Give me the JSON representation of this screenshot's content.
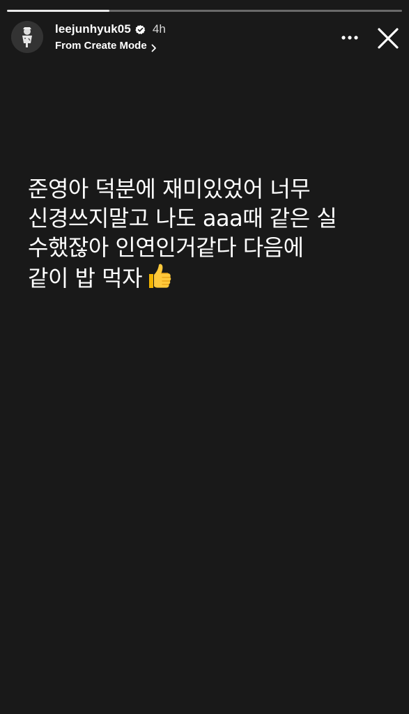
{
  "story": {
    "progress_fraction": 0.26,
    "background_color": "#191919",
    "accent_color": "#ffffff"
  },
  "header": {
    "avatar_icon": "profile-avatar",
    "username": "leejunhyuk05",
    "verified_icon": "verified-badge-icon",
    "timestamp": "4h",
    "subtitle": "From Create Mode",
    "subtitle_icon": "chevron-right-icon",
    "more_icon": "more-horizontal-icon",
    "close_icon": "close-icon"
  },
  "message": {
    "lines": [
      "준영아 덕분에 재미있었어 너무",
      "신경쓰지말고 나도 aaa때 같은 실",
      "수했잖아 인연인거같다 다음에",
      "같이 밥 먹자"
    ],
    "emoji": "thumbs-up-emoji"
  }
}
